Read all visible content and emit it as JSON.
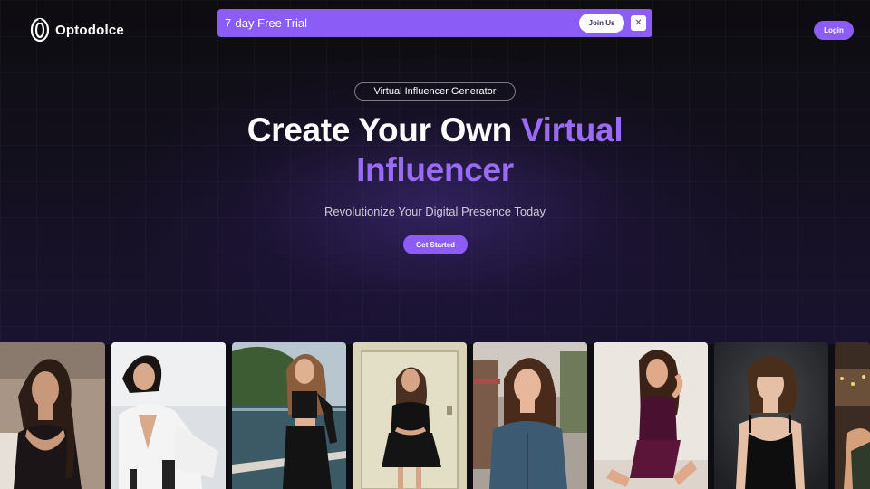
{
  "header": {
    "brand": "Optodolce",
    "login_label": "Login"
  },
  "promo": {
    "text": "7-day Free Trial",
    "join_label": "Join Us",
    "close_glyph": "✕"
  },
  "hero": {
    "badge": "Virtual Influencer Generator",
    "headline_white": "Create Your Own ",
    "headline_accent_1": "Virtual",
    "headline_accent_2": "Influencer",
    "subtitle": "Revolutionize Your Digital Presence Today",
    "cta_label": "Get Started"
  },
  "gallery": {
    "images": [
      {
        "name": "woman in black satin dress with braid"
      },
      {
        "name": "woman in white jacket seated"
      },
      {
        "name": "woman in black dress by lake"
      },
      {
        "name": "woman in black dress at door"
      },
      {
        "name": "woman in denim dress on street"
      },
      {
        "name": "woman in sequined purple dress"
      },
      {
        "name": "woman in black slip dress"
      },
      {
        "name": "partial woman outdoors"
      }
    ]
  },
  "colors": {
    "accent": "#8b5cf6",
    "accent_text": "#9a6cf5",
    "background": "#0f0d14"
  }
}
